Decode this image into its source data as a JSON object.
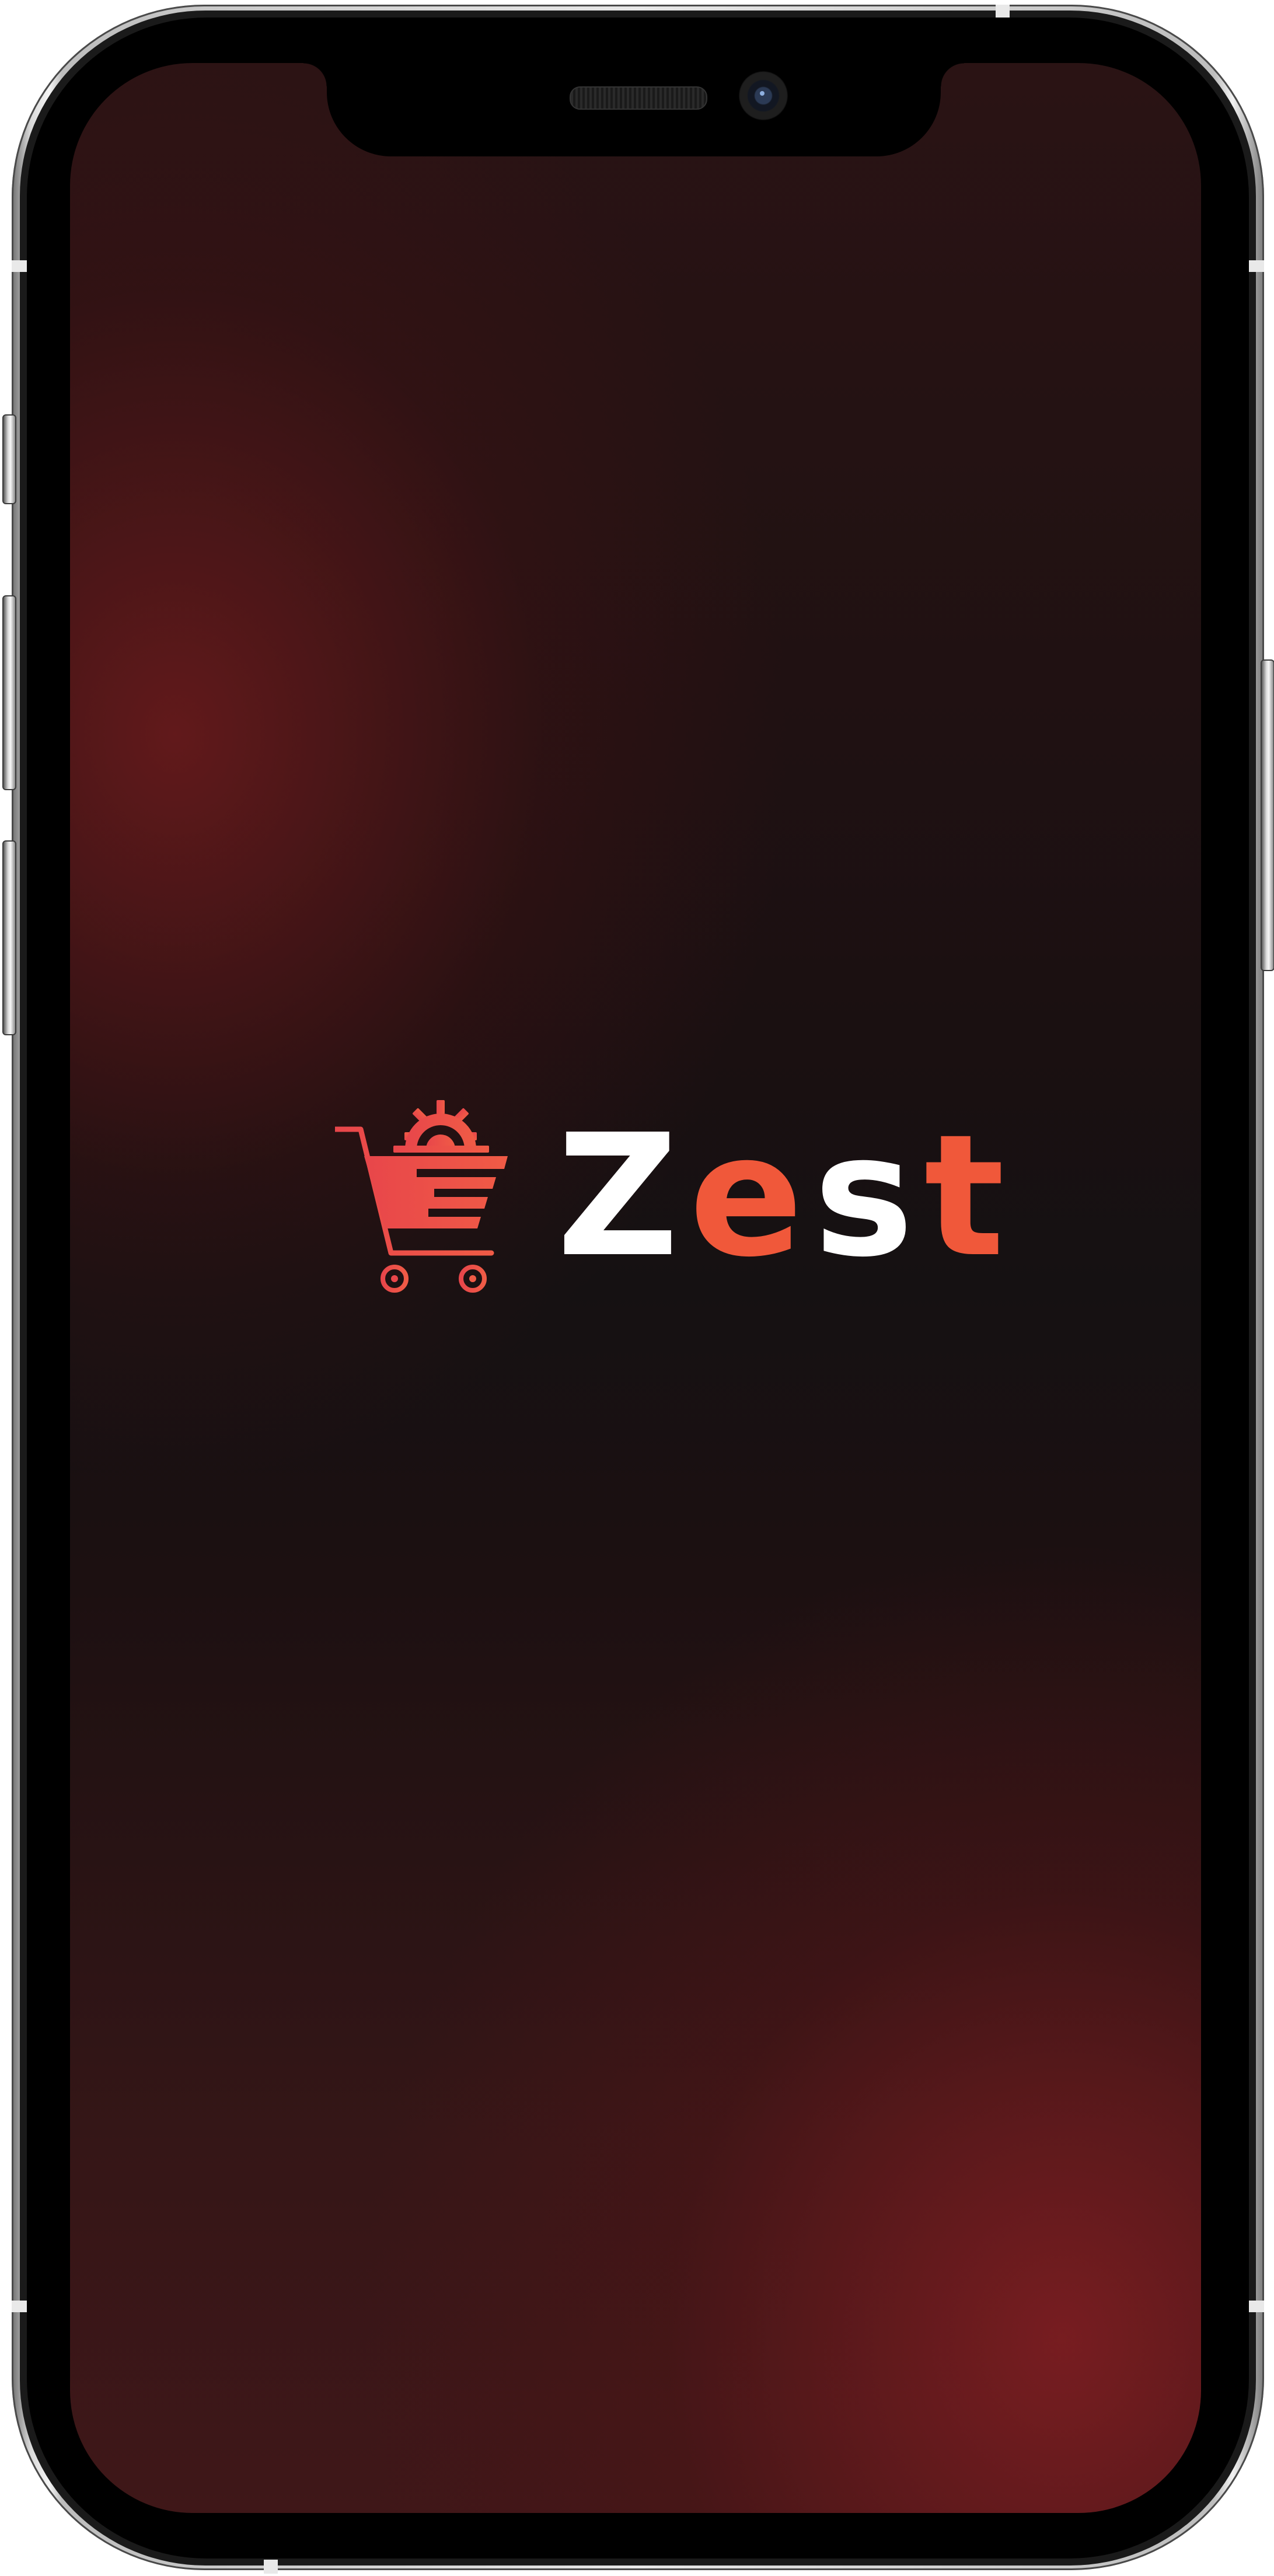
{
  "app": {
    "name_parts": [
      {
        "text": "Z",
        "color": "#ffffff"
      },
      {
        "text": "e",
        "color": "#f0583a"
      },
      {
        "text": "s",
        "color": "#ffffff"
      },
      {
        "text": "t",
        "color": "#f0583a"
      }
    ],
    "logo_icon": "shopping-cart-gear-icon",
    "accent_color": "#f0583a",
    "icon_color": "#e8464a",
    "background_colors": [
      "#3f1718",
      "#151112",
      "#4a1a1c"
    ]
  },
  "device": {
    "frame": "phone-with-notch"
  }
}
